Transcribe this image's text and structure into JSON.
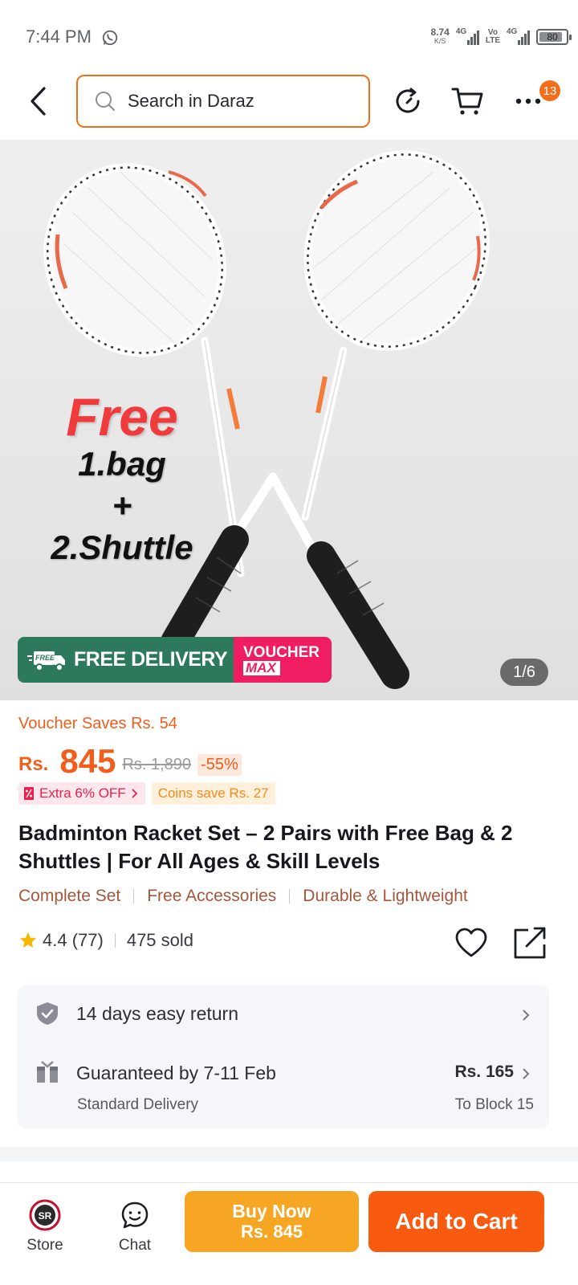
{
  "status_bar": {
    "time": "7:44 PM",
    "net_speed_value": "8.74",
    "net_speed_unit": "K/S",
    "sim1_label": "4G",
    "volte_l1": "Vo",
    "volte_l2": "LTE",
    "sim2_label": "4G",
    "battery": "80"
  },
  "header": {
    "search_placeholder": "Search in Daraz",
    "notification_count": "13"
  },
  "gallery": {
    "promo_free": "Free",
    "promo_line1": "1.bag",
    "promo_plus": "+",
    "promo_line2": "2.Shuttle",
    "delivery_badge_small": "FREE",
    "delivery_label": "FREE DELIVERY",
    "voucher_l1": "VOUCHER",
    "voucher_l2": "MAX",
    "page_indicator": "1/6"
  },
  "price": {
    "voucher_saves": "Voucher Saves Rs. 54",
    "currency": "Rs.",
    "current": "845",
    "original": "Rs. 1,890",
    "discount": "-55%",
    "extra_off": "Extra 6% OFF",
    "coins_save": "Coins save Rs. 27"
  },
  "product": {
    "title": "Badminton Racket Set – 2 Pairs with Free Bag & 2 Shuttles | For All Ages & Skill Levels",
    "features": [
      "Complete Set",
      "Free Accessories",
      "Durable & Lightweight"
    ],
    "rating": "4.4 (77)",
    "sold": "475 sold"
  },
  "service": {
    "return_text": "14 days easy return",
    "delivery_text": "Guaranteed by 7-11 Feb",
    "delivery_sub": "Standard Delivery",
    "delivery_fee": "Rs. 165",
    "delivery_location": "To Block 15"
  },
  "bottom_bar": {
    "store_label": "Store",
    "store_logo_text": "SR",
    "chat_label": "Chat",
    "buy_now_l1": "Buy Now",
    "buy_now_l2": "Rs. 845",
    "add_to_cart": "Add to Cart"
  },
  "colors": {
    "accent": "#f36e1b",
    "price": "#f35d1c",
    "buy_now": "#f6a623",
    "add_to_cart": "#f85b10",
    "free_delivery": "#2c7a5b",
    "voucher_max": "#ef1d62"
  },
  "icons": {
    "back": "back-arrow-icon",
    "search": "search-icon",
    "history": "history-icon",
    "cart": "cart-icon",
    "more": "more-dots-icon",
    "wishlist": "heart-icon",
    "share": "share-icon",
    "return": "shield-check-icon",
    "delivery": "package-icon",
    "store": "store-logo-icon",
    "chat": "chat-icon"
  }
}
